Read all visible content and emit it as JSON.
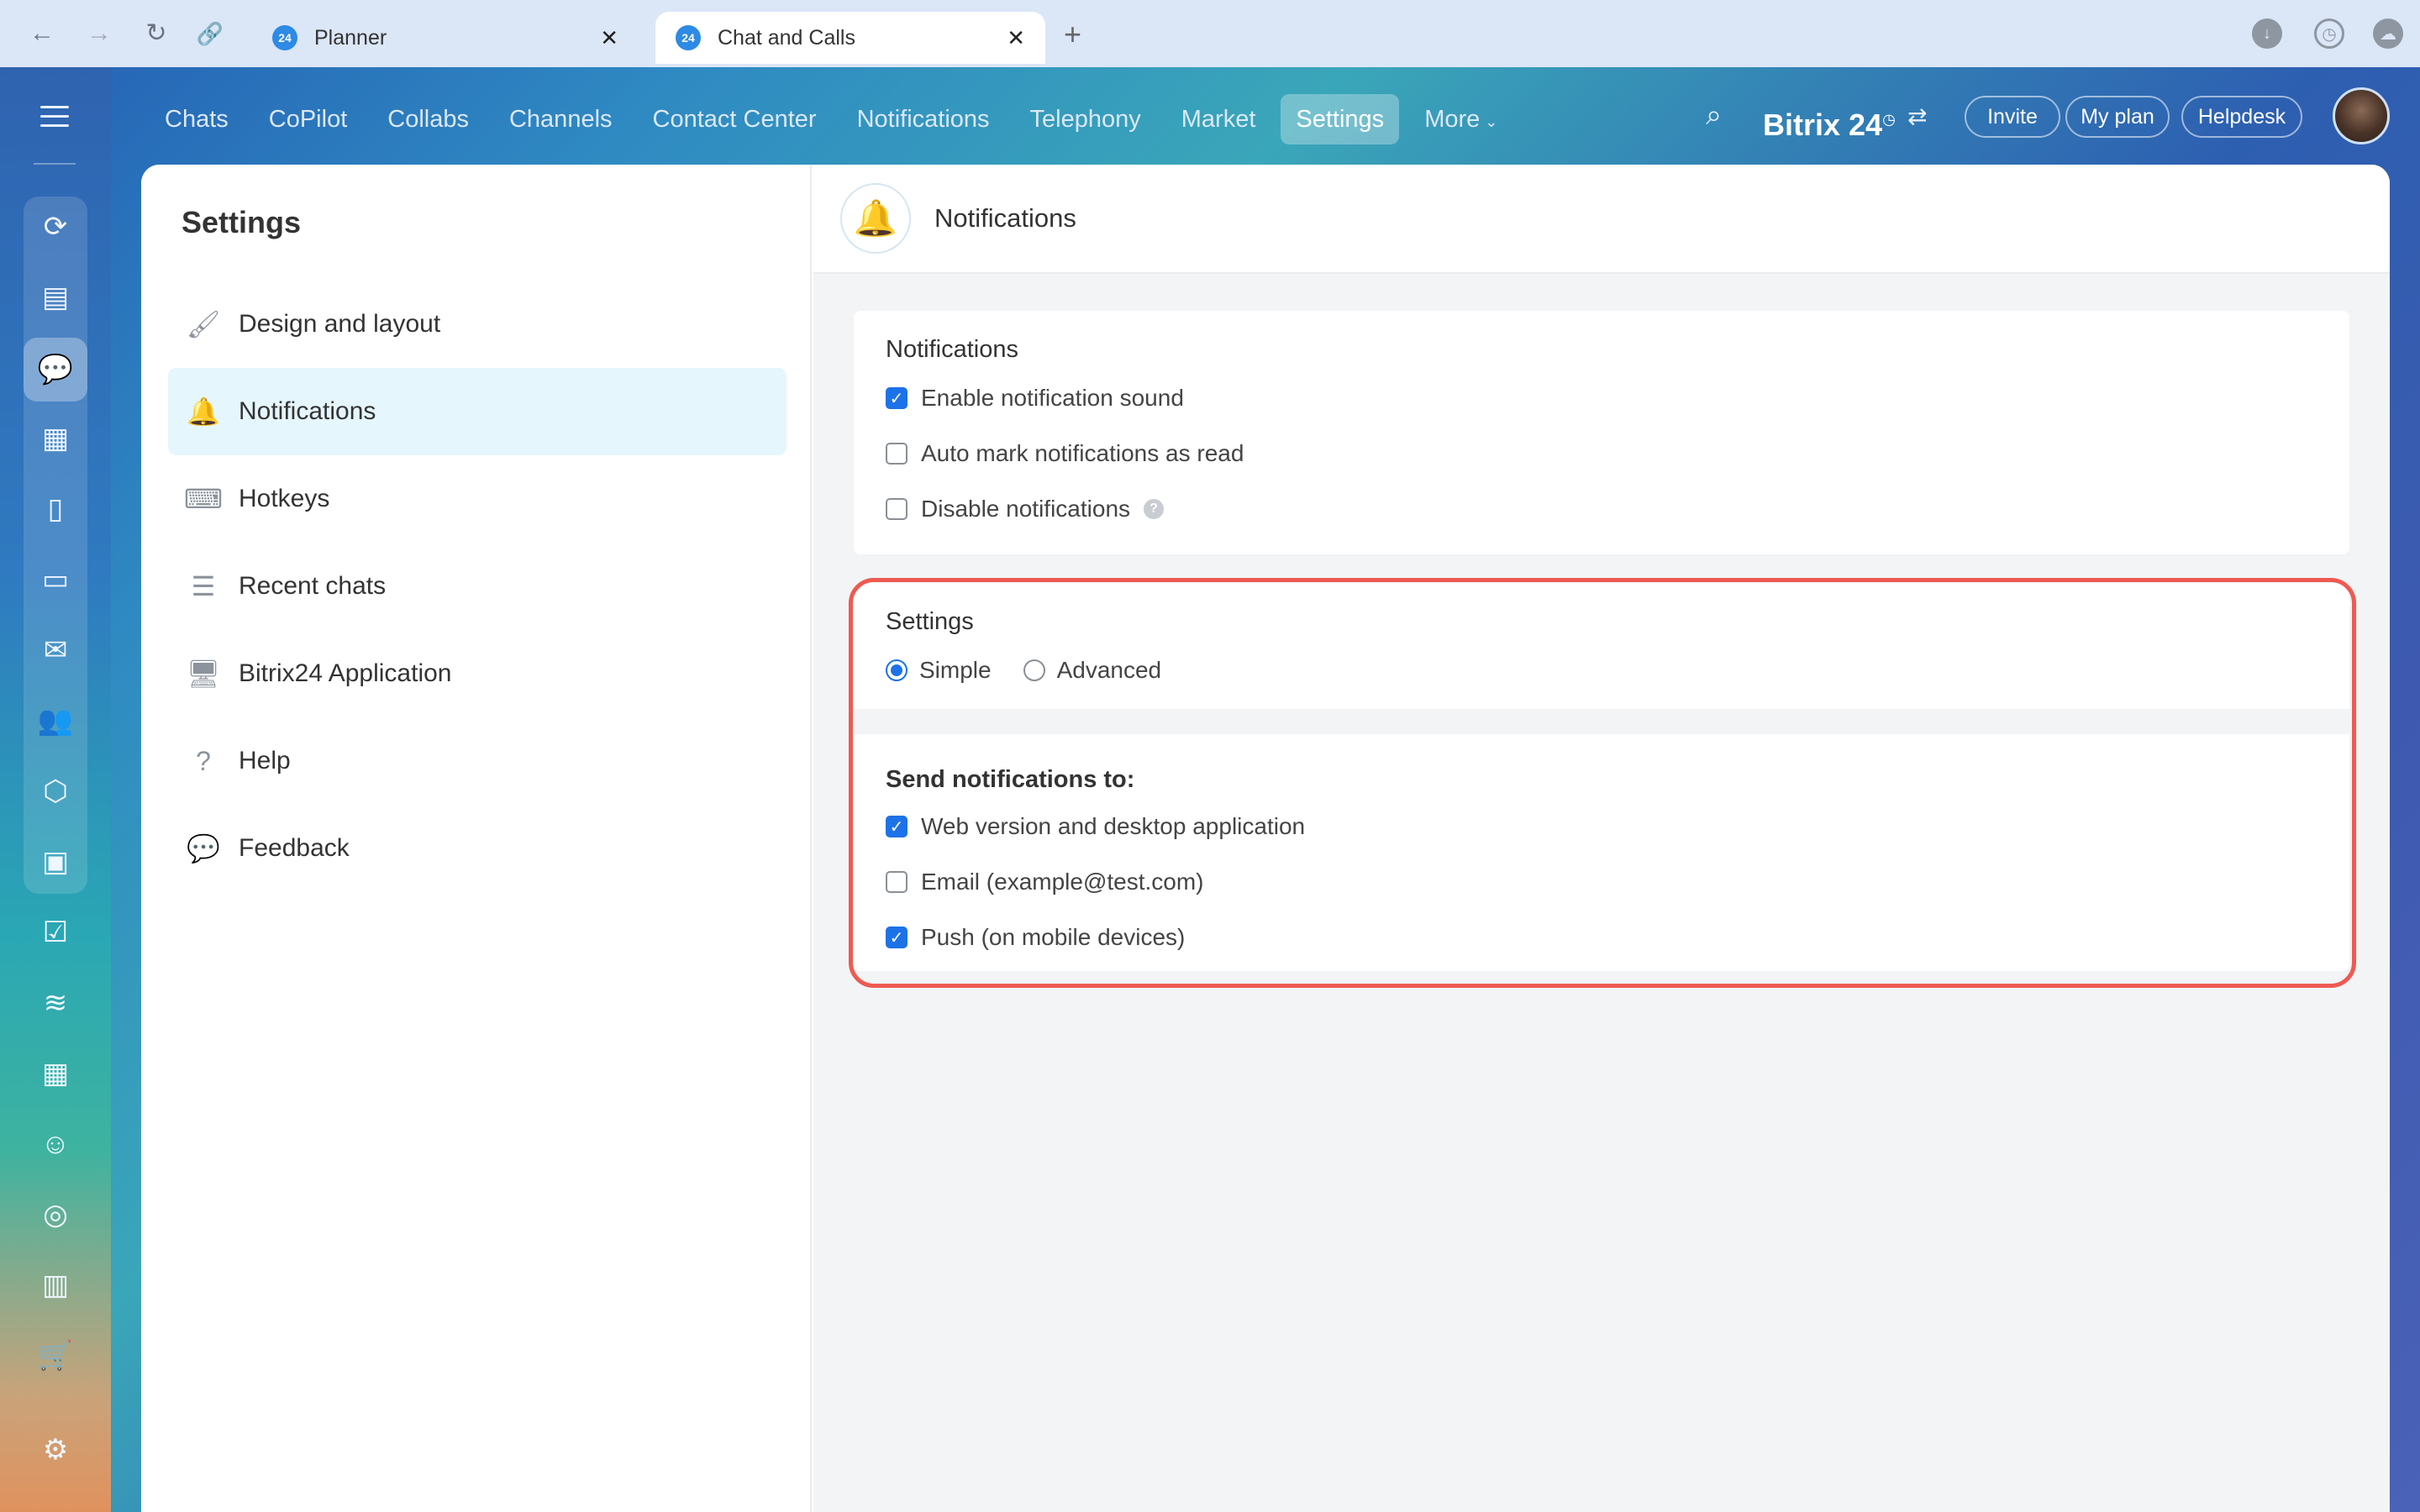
{
  "browser": {
    "tabs": [
      {
        "favicon": "24",
        "title": "Planner",
        "active": false
      },
      {
        "favicon": "24",
        "title": "Chat and Calls",
        "active": true
      }
    ],
    "close_glyph": "✕",
    "new_tab_glyph": "+"
  },
  "topnav": {
    "items": [
      "Chats",
      "CoPilot",
      "Collabs",
      "Channels",
      "Contact Center",
      "Notifications",
      "Telephony",
      "Market",
      "Settings",
      "More"
    ],
    "active": "Settings",
    "brand": "Bitrix 24",
    "buttons": {
      "invite": "Invite",
      "plan": "My plan",
      "help": "Helpdesk"
    }
  },
  "sidebar": {
    "title": "Settings",
    "items": [
      {
        "label": "Design and layout",
        "icon": "brush-icon"
      },
      {
        "label": "Notifications",
        "icon": "bell-icon",
        "selected": true
      },
      {
        "label": "Hotkeys",
        "icon": "keyboard-icon"
      },
      {
        "label": "Recent chats",
        "icon": "list-icon"
      },
      {
        "label": "Bitrix24 Application",
        "icon": "monitor-icon"
      },
      {
        "label": "Help",
        "icon": "question-icon"
      },
      {
        "label": "Feedback",
        "icon": "speech-bubble-icon"
      }
    ]
  },
  "content": {
    "header_title": "Notifications",
    "notifications_card": {
      "title": "Notifications",
      "options": [
        {
          "label": "Enable notification sound",
          "checked": true
        },
        {
          "label": "Auto mark notifications as read",
          "checked": false
        },
        {
          "label": "Disable notifications",
          "checked": false
        }
      ]
    },
    "settings_card": {
      "title": "Settings",
      "mode_options": [
        {
          "label": "Simple",
          "selected": true
        },
        {
          "label": "Advanced",
          "selected": false
        }
      ],
      "send_title": "Send notifications to:",
      "send_options": [
        {
          "label": "Web version and desktop application",
          "checked": true
        },
        {
          "label": "Email (example@test.com)",
          "checked": false
        },
        {
          "label": "Push (on mobile devices)",
          "checked": true
        }
      ]
    }
  },
  "colors": {
    "accent": "#1d72e8",
    "highlight": "#ee5a52",
    "selected_bg": "#e5f6fd"
  }
}
